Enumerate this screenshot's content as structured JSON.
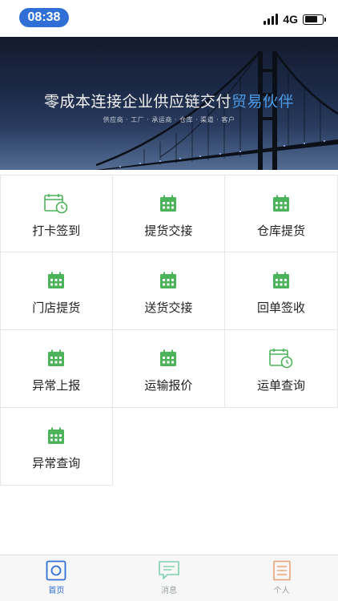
{
  "status_bar": {
    "time": "08:38",
    "network": "4G",
    "battery_level": 0.8
  },
  "banner": {
    "title_main": "零成本连接企业供应链交付",
    "title_highlight": "贸易伙伴",
    "subtitle": "供应商 · 工厂 · 承运商 · 仓库 · 渠道 · 客户"
  },
  "grid": {
    "items": [
      {
        "label": "打卡签到",
        "icon": "calendar-clock-icon"
      },
      {
        "label": "提货交接",
        "icon": "calendar-icon"
      },
      {
        "label": "仓库提货",
        "icon": "calendar-icon"
      },
      {
        "label": "门店提货",
        "icon": "calendar-icon"
      },
      {
        "label": "送货交接",
        "icon": "calendar-icon"
      },
      {
        "label": "回单签收",
        "icon": "calendar-icon"
      },
      {
        "label": "异常上报",
        "icon": "calendar-icon"
      },
      {
        "label": "运输报价",
        "icon": "calendar-icon"
      },
      {
        "label": "运单查询",
        "icon": "calendar-clock-icon"
      },
      {
        "label": "异常查询",
        "icon": "calendar-icon"
      }
    ]
  },
  "tabs": [
    {
      "label": "首页",
      "icon": "home-icon",
      "active": true
    },
    {
      "label": "消息",
      "icon": "message-icon",
      "active": false
    },
    {
      "label": "个人",
      "icon": "document-icon",
      "active": false
    }
  ],
  "colors": {
    "accent": "#2f6fd6",
    "icon_green": "#4cb35b",
    "msg_tab": "#7fcfae",
    "me_tab": "#e8a070",
    "highlight": "#4d9be6"
  }
}
